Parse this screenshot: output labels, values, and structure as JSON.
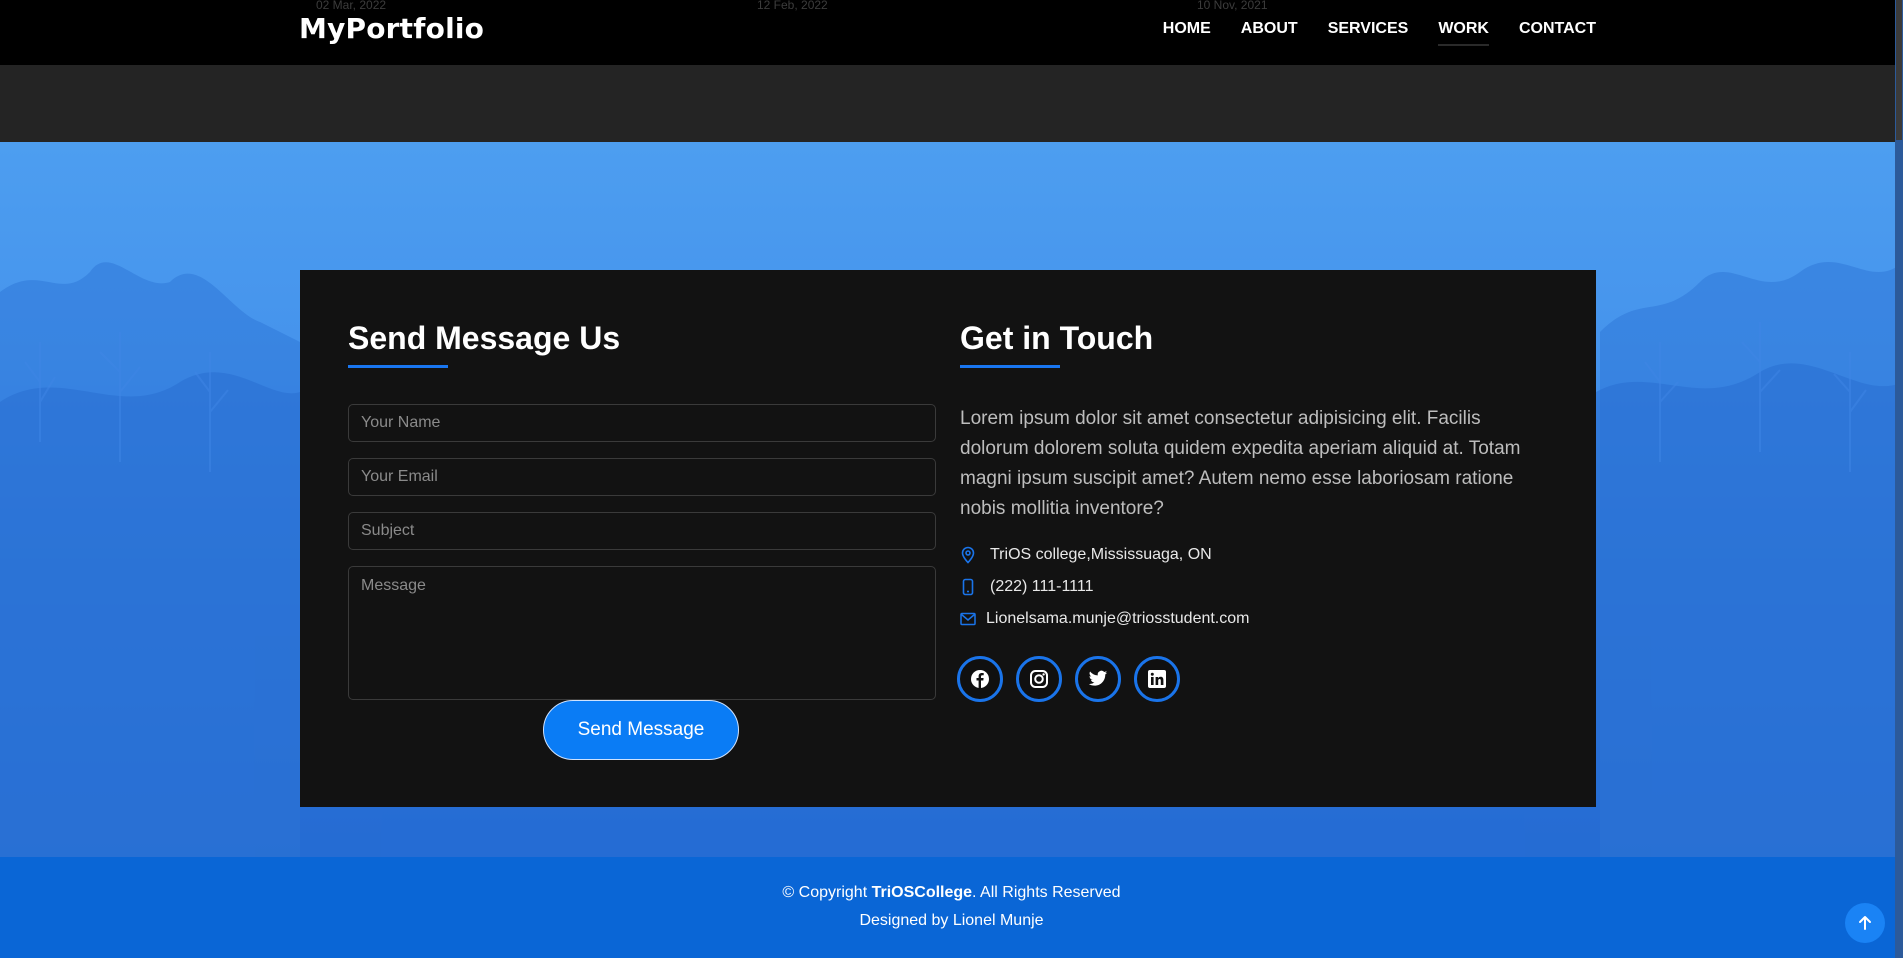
{
  "navbar": {
    "brand": "MyPortfolio",
    "links": [
      "HOME",
      "ABOUT",
      "SERVICES",
      "WORK",
      "CONTACT"
    ],
    "active": "WORK",
    "ghost_dates": [
      "02 Mar, 2022",
      "12 Feb, 2022",
      "10 Nov, 2021"
    ]
  },
  "contact_form": {
    "title": "Send Message Us",
    "name_placeholder": "Your Name",
    "email_placeholder": "Your Email",
    "subject_placeholder": "Subject",
    "message_placeholder": "Message",
    "submit_label": "Send Message"
  },
  "get_in_touch": {
    "title": "Get in Touch",
    "description": "Lorem ipsum dolor sit amet consectetur adipisicing elit. Facilis dolorum dolorem soluta quidem expedita aperiam aliquid at. Totam magni ipsum suscipit amet? Autem nemo esse laboriosam ratione nobis mollitia inventore?",
    "address": "TriOS college,Mississuaga, ON",
    "phone": "(222) 111-1111",
    "email": "Lionelsama.munje@triosstudent.com",
    "socials": [
      "facebook-icon",
      "instagram-icon",
      "twitter-icon",
      "linkedin-icon"
    ]
  },
  "footer": {
    "copyright_prefix": "© Copyright ",
    "company": "TriOSCollege",
    "copyright_suffix": ". All Rights Reserved",
    "designed_by": "Designed by Lionel Munje"
  },
  "colors": {
    "accent": "#0a7cf5",
    "hero_blue": "#4593ec",
    "card_bg": "#121212",
    "footer_bg": "#0a66d6"
  }
}
